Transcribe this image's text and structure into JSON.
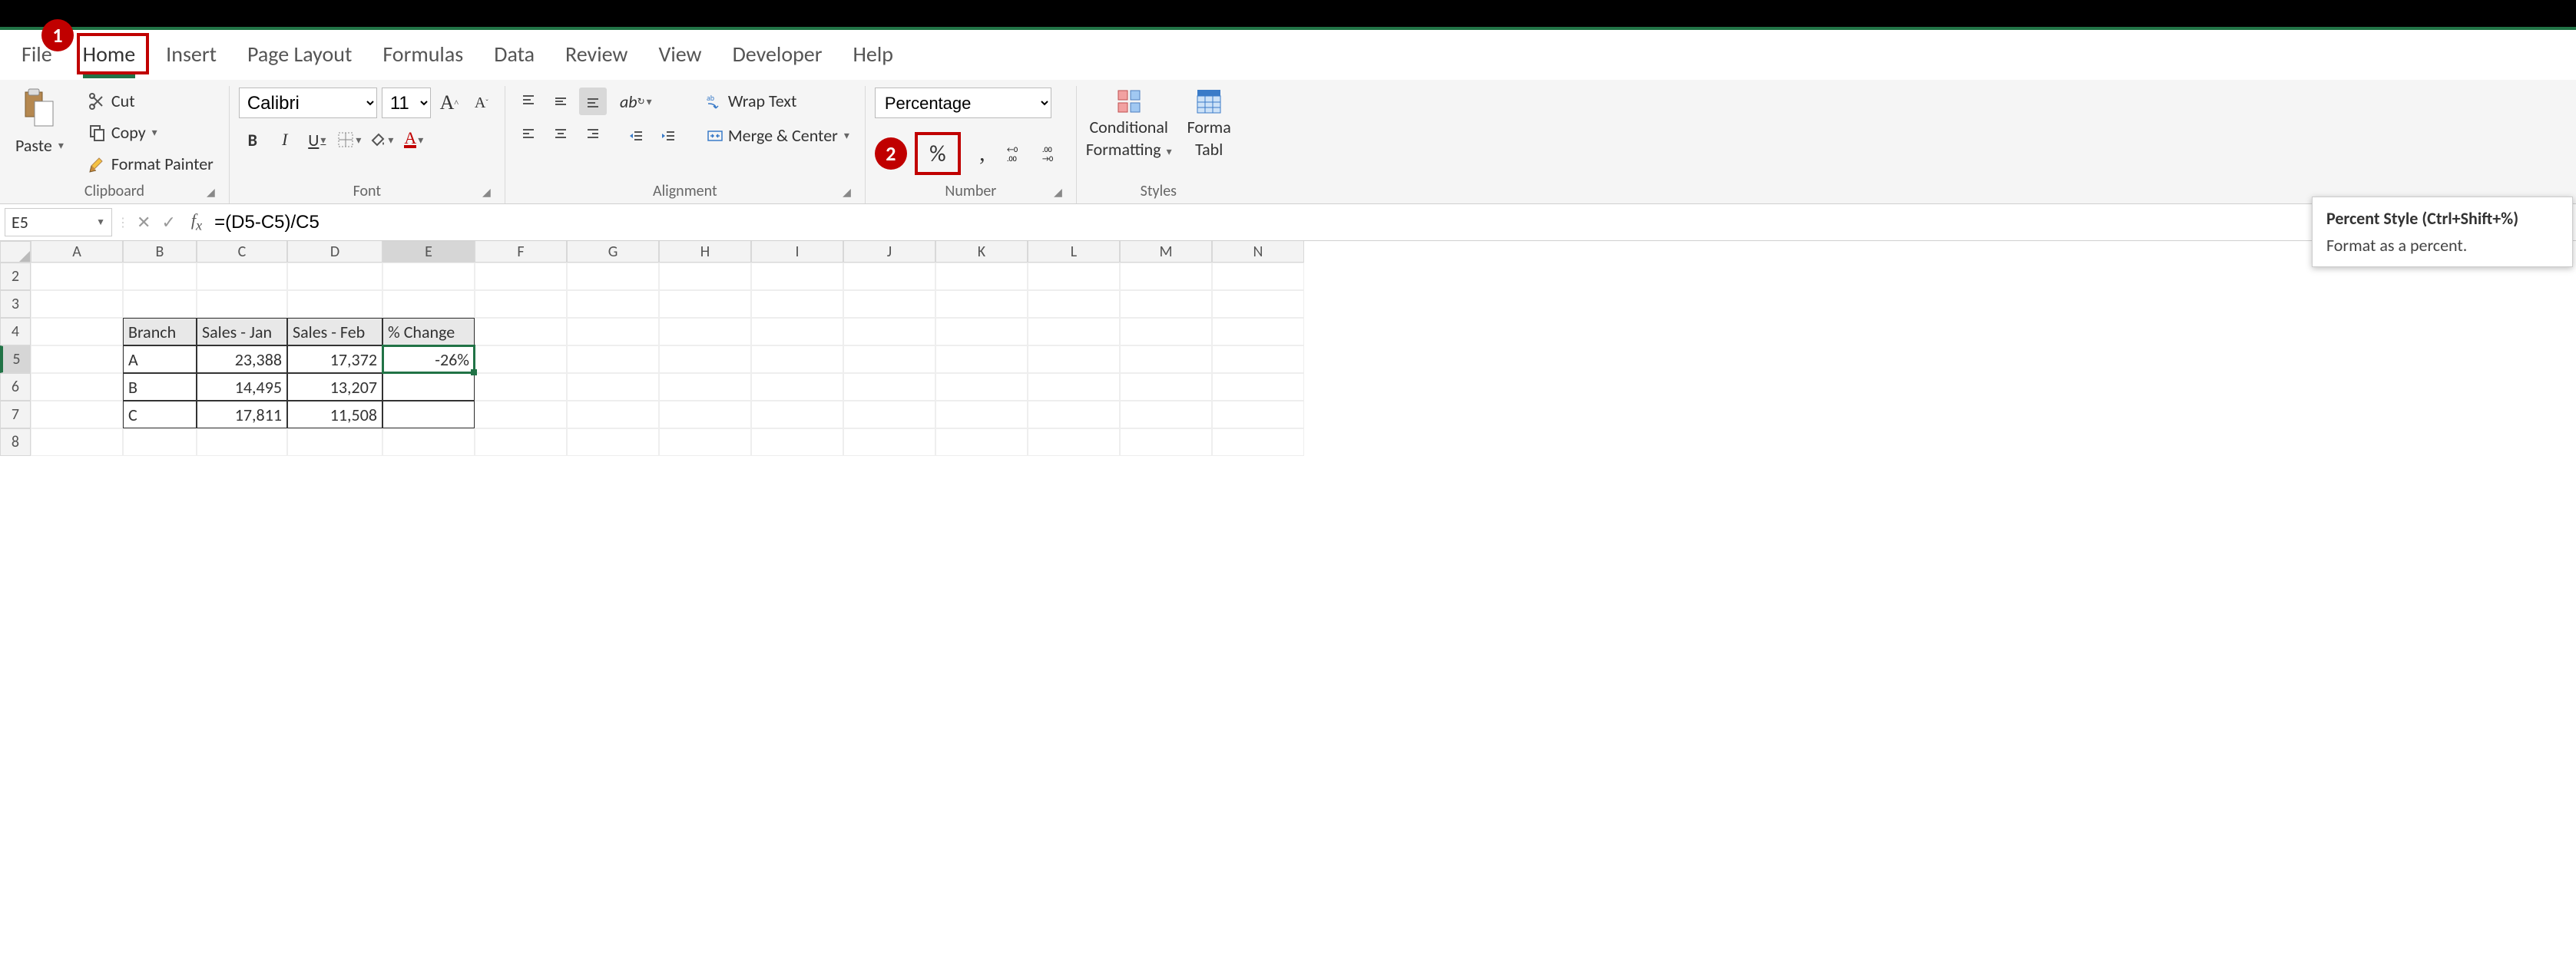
{
  "tabs": {
    "file": "File",
    "home": "Home",
    "insert": "Insert",
    "page_layout": "Page Layout",
    "formulas": "Formulas",
    "data": "Data",
    "review": "Review",
    "view": "View",
    "developer": "Developer",
    "help": "Help"
  },
  "callouts": {
    "one": "1",
    "two": "2"
  },
  "clipboard": {
    "paste": "Paste",
    "cut": "Cut",
    "copy": "Copy",
    "format_painter": "Format Painter",
    "group": "Clipboard"
  },
  "font": {
    "name": "Calibri",
    "size": "11",
    "bold": "B",
    "italic": "I",
    "underline": "U",
    "group": "Font"
  },
  "alignment": {
    "wrap": "Wrap Text",
    "merge": "Merge & Center",
    "group": "Alignment"
  },
  "number": {
    "format": "Percentage",
    "percent": "%",
    "comma": ",",
    "group": "Number"
  },
  "styles": {
    "conditional": "Conditional",
    "formatting": "Formatting",
    "format_as": "Forma",
    "table": "Tabl",
    "group": "Styles"
  },
  "tooltip": {
    "title": "Percent Style (Ctrl+Shift+%)",
    "body": "Format as a percent."
  },
  "namebox": "E5",
  "formula": "=(D5-C5)/C5",
  "columns": [
    "A",
    "B",
    "C",
    "D",
    "E",
    "F",
    "G",
    "H",
    "I",
    "J",
    "K",
    "L",
    "M",
    "N"
  ],
  "rows": [
    "2",
    "3",
    "4",
    "5",
    "6",
    "7",
    "8"
  ],
  "table": {
    "headers": {
      "branch": "Branch",
      "jan": "Sales - Jan",
      "feb": "Sales - Feb",
      "pct": "% Change"
    },
    "rows": [
      {
        "branch": "A",
        "jan": "23,388",
        "feb": "17,372",
        "pct": "-26%"
      },
      {
        "branch": "B",
        "jan": "14,495",
        "feb": "13,207",
        "pct": ""
      },
      {
        "branch": "C",
        "jan": "17,811",
        "feb": "11,508",
        "pct": ""
      }
    ]
  }
}
